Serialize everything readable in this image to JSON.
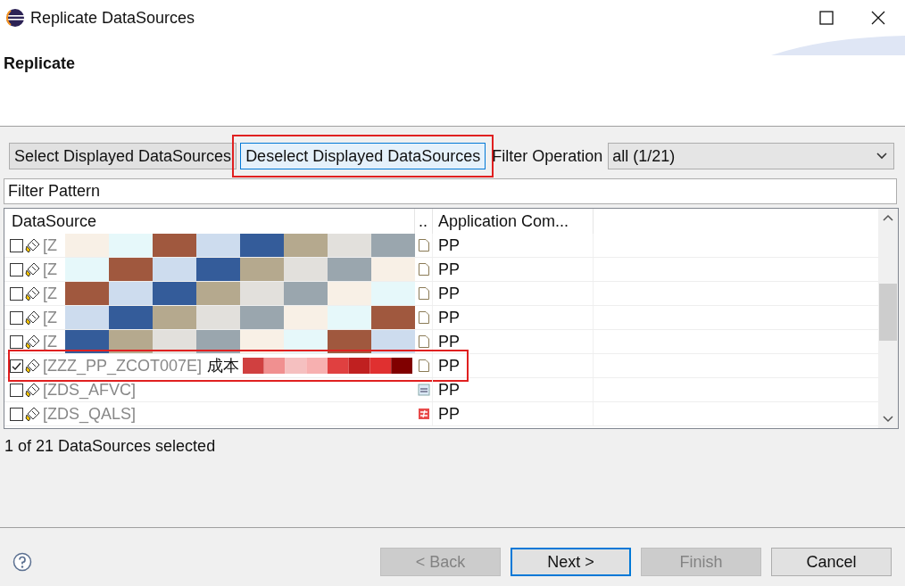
{
  "window": {
    "title": "Replicate DataSources"
  },
  "header": {
    "title": "Replicate"
  },
  "toolbar": {
    "buttons": [
      {
        "label": "Select Displayed DataSources",
        "focused": false,
        "annotated": false
      },
      {
        "label": "Deselect Displayed DataSources",
        "focused": true,
        "annotated": true
      }
    ],
    "filter_operation": {
      "label": "Filter Operation",
      "value": "all (1/21)"
    }
  },
  "filter_pattern": {
    "placeholder": "Filter Pattern"
  },
  "table": {
    "columns": [
      "DataSource",
      "..",
      "Application Com..."
    ],
    "rows": [
      {
        "checked": false,
        "name": "[Z",
        "redacted": true,
        "kind": "document",
        "app": "PP"
      },
      {
        "checked": false,
        "name": "[Z",
        "redacted": true,
        "kind": "document",
        "app": "PP"
      },
      {
        "checked": false,
        "name": "[Z",
        "redacted": true,
        "kind": "document",
        "app": "PP"
      },
      {
        "checked": false,
        "name": "[Z",
        "redacted": true,
        "kind": "document",
        "app": "PP"
      },
      {
        "checked": false,
        "name": "[Z",
        "redacted": true,
        "kind": "document",
        "app": "PP"
      },
      {
        "checked": true,
        "name": "[ZZZ_PP_ZCOT007E]",
        "suffix": "成本",
        "redacted": true,
        "kind": "document",
        "app": "PP",
        "annotated": true
      },
      {
        "checked": false,
        "name": "[ZDS_AFVC]",
        "kind": "list",
        "app": "PP"
      },
      {
        "checked": false,
        "name": "[ZDS_QALS]",
        "kind": "diff",
        "app": "PP"
      }
    ]
  },
  "status": "1 of 21 DataSources selected",
  "buttons": [
    {
      "label": "< Back",
      "disabled": true,
      "default": false
    },
    {
      "label": "Next >",
      "disabled": false,
      "default": true
    },
    {
      "label": "Finish",
      "disabled": true,
      "default": false
    },
    {
      "label": "Cancel",
      "disabled": false,
      "default": false
    }
  ]
}
